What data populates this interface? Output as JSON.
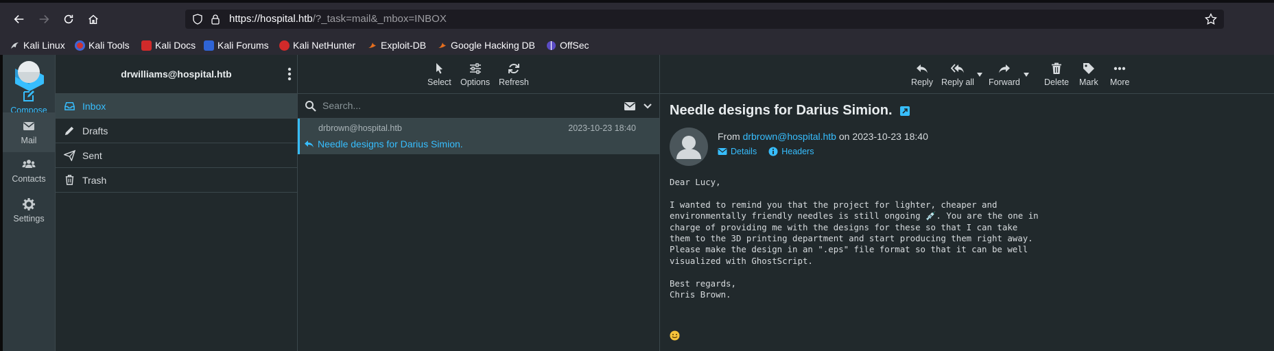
{
  "browser": {
    "url_host": "https://hospital.htb",
    "url_path": "/?_task=mail&_mbox=INBOX",
    "bookmarks": [
      "Kali Linux",
      "Kali Tools",
      "Kali Docs",
      "Kali Forums",
      "Kali NetHunter",
      "Exploit-DB",
      "Google Hacking DB",
      "OffSec"
    ]
  },
  "rail": {
    "compose": "Compose",
    "mail": "Mail",
    "contacts": "Contacts",
    "settings": "Settings"
  },
  "account": "drwilliams@hospital.htb",
  "folders": [
    "Inbox",
    "Drafts",
    "Sent",
    "Trash"
  ],
  "list_toolbar": {
    "select": "Select",
    "options": "Options",
    "refresh": "Refresh"
  },
  "search": {
    "placeholder": "Search..."
  },
  "message_list": [
    {
      "from": "drbrown@hospital.htb",
      "date": "2023-10-23 18:40",
      "subject": "Needle designs for Darius Simion."
    }
  ],
  "reader_toolbar": {
    "reply": "Reply",
    "reply_all": "Reply all",
    "forward": "Forward",
    "delete": "Delete",
    "mark": "Mark",
    "more": "More"
  },
  "message": {
    "subject": "Needle designs for Darius Simion.",
    "from_label": "From",
    "from_address": "drbrown@hospital.htb",
    "on_label": "on",
    "date": "2023-10-23 18:40",
    "details": "Details",
    "headers": "Headers",
    "body": "Dear Lucy,\n\nI wanted to remind you that the project for lighter, cheaper and\nenvironmentally friendly needles is still ongoing 💉. You are the one in\ncharge of providing me with the designs for these so that I can take\nthem to the 3D printing department and start producing them right away.\nPlease make the design in an \".eps\" file format so that it can be well\nvisualized with GhostScript.\n\nBest regards,\nChris Brown."
  },
  "colors": {
    "accent": "#37beff",
    "background": "#21292c",
    "rail": "#2f3a3f"
  }
}
